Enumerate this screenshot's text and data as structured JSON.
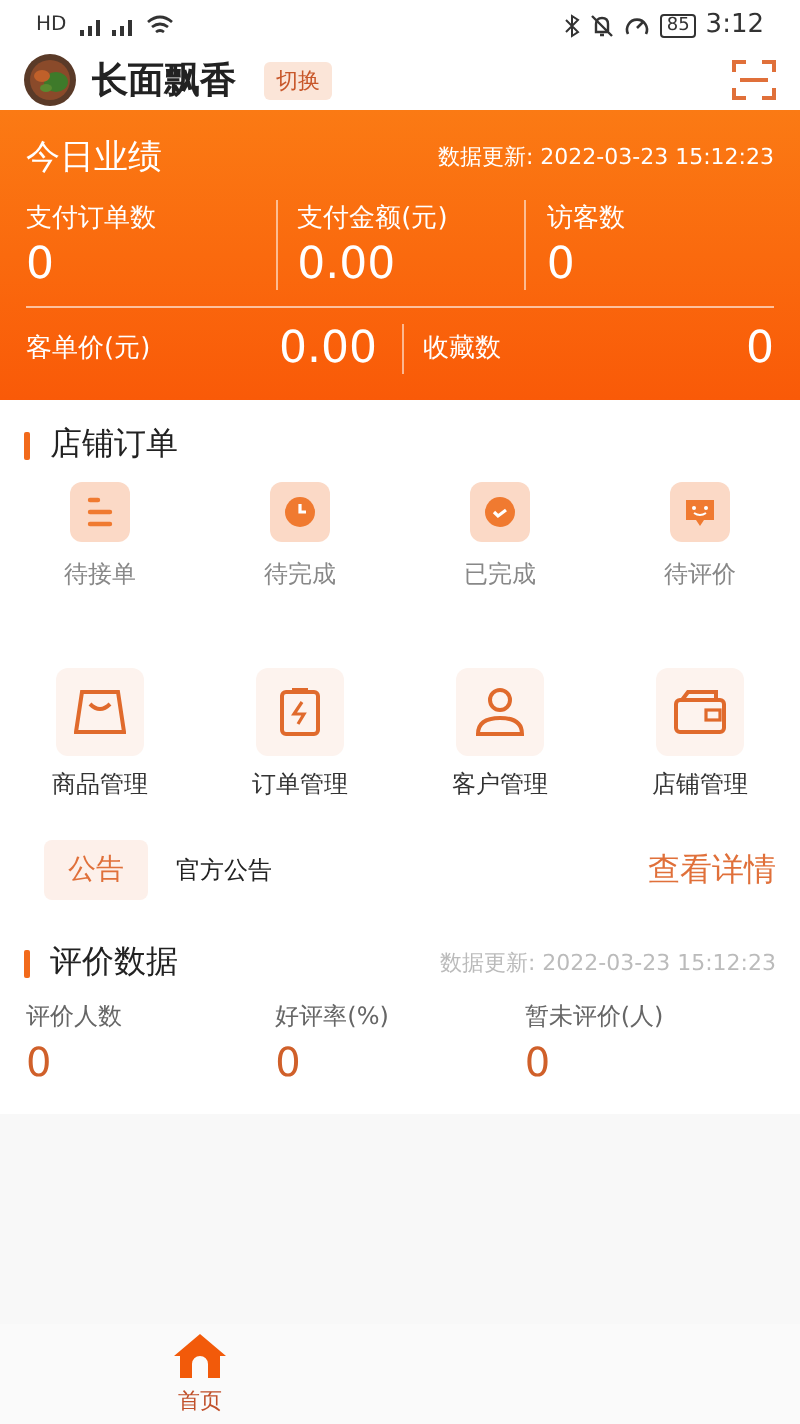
{
  "status_bar": {
    "left": "HD",
    "time": "3:12",
    "battery": "85"
  },
  "header": {
    "shop_name": "长面飘香",
    "switch_label": "切换"
  },
  "today": {
    "title": "今日业绩",
    "updated": "数据更新:  2022-03-23 15:12:23",
    "stats": [
      {
        "label": "支付订单数",
        "value": "0"
      },
      {
        "label": "支付金额(元)",
        "value": "0.00"
      },
      {
        "label": "访客数",
        "value": "0"
      }
    ],
    "bottom": [
      {
        "label": "客单价(元)",
        "value": "0.00"
      },
      {
        "label": "收藏数",
        "value": "0"
      }
    ]
  },
  "orders": {
    "title": "店铺订单",
    "items": [
      {
        "label": "待接单",
        "kind": "list"
      },
      {
        "label": "待完成",
        "kind": "clock"
      },
      {
        "label": "已完成",
        "kind": "check"
      },
      {
        "label": "待评价",
        "kind": "chat"
      }
    ]
  },
  "tools": [
    {
      "label": "商品管理",
      "kind": "bag"
    },
    {
      "label": "订单管理",
      "kind": "clipboard"
    },
    {
      "label": "客户管理",
      "kind": "person"
    },
    {
      "label": "店铺管理",
      "kind": "wallet"
    }
  ],
  "notice": {
    "tag": "公告",
    "text": "官方公告",
    "link": "查看详情"
  },
  "reviews": {
    "title": "评价数据",
    "updated": "数据更新:  2022-03-23 15:12:23",
    "stats": [
      {
        "label": "评价人数",
        "value": "0"
      },
      {
        "label": "好评率(%)",
        "value": "0"
      },
      {
        "label": "暂未评价(人)",
        "value": "0"
      }
    ]
  },
  "tabbar": [
    {
      "label": "首页",
      "selected": true
    }
  ]
}
